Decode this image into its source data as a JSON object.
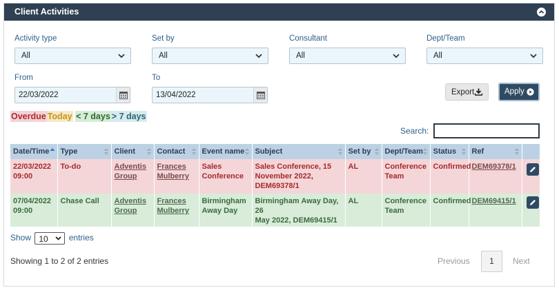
{
  "panel": {
    "title": "Client Activities"
  },
  "filters": {
    "activity_type": {
      "label": "Activity type",
      "value": "All"
    },
    "set_by": {
      "label": "Set by",
      "value": "All"
    },
    "consultant": {
      "label": "Consultant",
      "value": "All"
    },
    "dept_team": {
      "label": "Dept/Team",
      "value": "All"
    },
    "from": {
      "label": "From",
      "value": "22/03/2022"
    },
    "to": {
      "label": "To",
      "value": "13/04/2022"
    }
  },
  "actions": {
    "export_label": "Export",
    "apply_label": "Apply"
  },
  "legend": {
    "overdue": "Overdue",
    "today": "Today",
    "lt7": "< 7 days",
    "gt7": "> 7 days"
  },
  "search": {
    "label": "Search:",
    "value": ""
  },
  "table": {
    "columns": [
      "Date/Time",
      "Type",
      "Client",
      "Contact",
      "Event name",
      "Subject",
      "Set by",
      "Dept/Team",
      "Status",
      "Ref"
    ],
    "rows": [
      {
        "status_class": "overdue",
        "date": "22/03/2022",
        "time": "09:00",
        "type": "To-do",
        "client_l1": "Adventis",
        "client_l2": "Group",
        "contact_l1": "Frances",
        "contact_l2": "Mulberry",
        "event_l1": "Sales",
        "event_l2": "Conference",
        "subject_l1": "Sales Conference, 15",
        "subject_l2": "November 2022,",
        "subject_l3": "DEM69378/1",
        "set_by": "AL",
        "dept_l1": "Conference",
        "dept_l2": "Team",
        "status": "Confirmed",
        "ref": "DEM69378/1"
      },
      {
        "status_class": "lt7",
        "date": "07/04/2022",
        "time": "09:00",
        "type": "Chase Call",
        "client_l1": "Adventis",
        "client_l2": "Group",
        "contact_l1": "Frances",
        "contact_l2": "Mulberry",
        "event_l1": "Birmingham",
        "event_l2": "Away Day",
        "subject_l1": "Birmingham Away Day, 26",
        "subject_l2": "May 2022, DEM69415/1",
        "subject_l3": "",
        "set_by": "AL",
        "dept_l1": "Conference",
        "dept_l2": "Team",
        "status": "Confirmed",
        "ref": "DEM69415/1"
      }
    ]
  },
  "length": {
    "show": "Show",
    "value": "10",
    "entries": "entries"
  },
  "footer": {
    "info": "Showing 1 to 2 of 2 entries"
  },
  "pagination": {
    "previous": "Previous",
    "current": "1",
    "next": "Next"
  },
  "icons": {
    "collapse": "chevron-up-circle-icon",
    "select": "chevron-down-icon",
    "calendar": "calendar-icon",
    "export": "download-icon",
    "apply": "play-circle-icon",
    "sort": "sort-icon",
    "edit": "pencil-icon"
  },
  "colors": {
    "header_bg": "#2f4053",
    "overdue_bg": "#f4d6d8",
    "overdue_text": "#a62a2e",
    "lt7_bg": "#d8ecd9",
    "lt7_text": "#3c6b3c",
    "table_head_bg": "#bcd2e4",
    "apply_bg": "#2f4b63"
  }
}
